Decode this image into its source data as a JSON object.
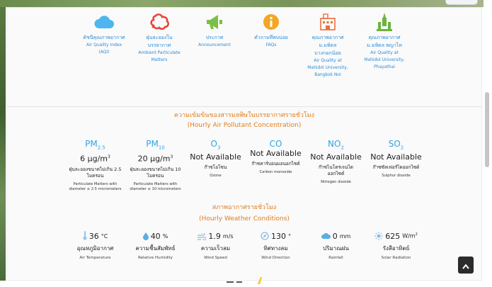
{
  "nav": {
    "items": [
      {
        "th": "ดัชนีคุณภาพอากาศ",
        "en": [
          "Air Quality Index",
          "(AQI)"
        ],
        "icon": "cloud-icon"
      },
      {
        "th": "ฝุ่นละอองใน บรรยากาศ",
        "en": [
          "Ambient Particulate",
          "Matters"
        ],
        "icon": "dust-icon"
      },
      {
        "th": "ประกาศ",
        "en": [
          "Announcement"
        ],
        "icon": "megaphone-icon"
      },
      {
        "th": "คำถามที่พบบ่อย",
        "en": [
          "FAQs"
        ],
        "icon": "info-icon"
      },
      {
        "th": "คุณภาพอากาศ ม.มหิดล บางกอกน้อย",
        "en": [
          "Air Quality at",
          "Mahidol University,",
          "Bangkok Noi"
        ],
        "icon": "building-icon"
      },
      {
        "th": "คุณภาพอากาศ ม.มหิดล พญาไท",
        "en": [
          "Air Quality at",
          "Mahidol University,",
          "Phayathai"
        ],
        "icon": "tower-icon"
      }
    ]
  },
  "pollutant_header": {
    "th": "ความเข้มข้นของสารมลพิษในบรรยากาศรายชั่วโมง",
    "en": "(Hourly Air Pollutant Concentration)"
  },
  "pollutants": [
    {
      "name": "PM",
      "sub": "2.5",
      "value": "6",
      "unit": "μg/m",
      "unit_sup": "3",
      "th": "ฝุ่นละอองขนาดไม่เกิน 2.5 ไมครอน",
      "en": "Particulate Matters with diameter ≤ 2.5 micrometers"
    },
    {
      "name": "PM",
      "sub": "10",
      "value": "20",
      "unit": "μg/m",
      "unit_sup": "3",
      "th": "ฝุ่นละอองขนาดไม่เกิน 10 ไมครอน",
      "en": "Particulate Matters with diameter ≤ 10 micrometers"
    },
    {
      "name": "O",
      "sub": "3",
      "value": "Not Available",
      "unit": "",
      "unit_sup": "",
      "th": "ก๊าซโอโซน",
      "en": "Ozone"
    },
    {
      "name": "CO",
      "sub": "",
      "value": "Not Available",
      "unit": "",
      "unit_sup": "",
      "th": "ก๊าซคาร์บอนมอนอกไซด์",
      "en": "Carbon monoxide"
    },
    {
      "name": "NO",
      "sub": "2",
      "value": "Not Available",
      "unit": "",
      "unit_sup": "",
      "th": "ก๊าซไนโตรเจนได ออกไซด์",
      "en": "Nitrogen dioxide"
    },
    {
      "name": "SO",
      "sub": "2",
      "value": "Not Available",
      "unit": "",
      "unit_sup": "",
      "th": "ก๊าซซัลเฟอร์ไดออกไซด์",
      "en": "Sulphur dioxide"
    }
  ],
  "weather_header": {
    "th": "สภาพอากาศรายชั่วโมง",
    "en": "(Hourly Weather Conditions)"
  },
  "weather": [
    {
      "icon": "thermometer-icon",
      "value": "36",
      "unit": "°C",
      "unit_sup": "",
      "th": "อุณหภูมิอากาศ",
      "en": "Air Temperature"
    },
    {
      "icon": "droplet-icon",
      "value": "40",
      "unit": "%",
      "unit_sup": "",
      "th": "ความชื้นสัมพัทธ์",
      "en": "Relative Humidity"
    },
    {
      "icon": "wind-icon",
      "value": "1.9",
      "unit": "m/s",
      "unit_sup": "",
      "th": "ความเร็วลม",
      "en": "Wind Speed"
    },
    {
      "icon": "compass-icon",
      "value": "130",
      "unit": "°",
      "unit_sup": "",
      "th": "ทิศทางลม",
      "en": "Wind Direction"
    },
    {
      "icon": "rain-cloud-icon",
      "value": "0",
      "unit": "mm",
      "unit_sup": "",
      "th": "ปริมาณฝน",
      "en": "Rainfall"
    },
    {
      "icon": "sun-icon",
      "value": "625",
      "unit": "W/m",
      "unit_sup": "2",
      "th": "รังสีอาทิตย์",
      "en": "Solar Radiation"
    }
  ],
  "colors": {
    "accent_blue": "#2d8bd4",
    "pollutant_blue": "#2ea5e6",
    "header_orange": "#e07d1b",
    "cloud": "#4db6ee",
    "dust": "#e8453c",
    "megaphone": "#7bc043",
    "info": "#f5a623",
    "building": "#e8713c",
    "tower": "#6cb33f"
  }
}
